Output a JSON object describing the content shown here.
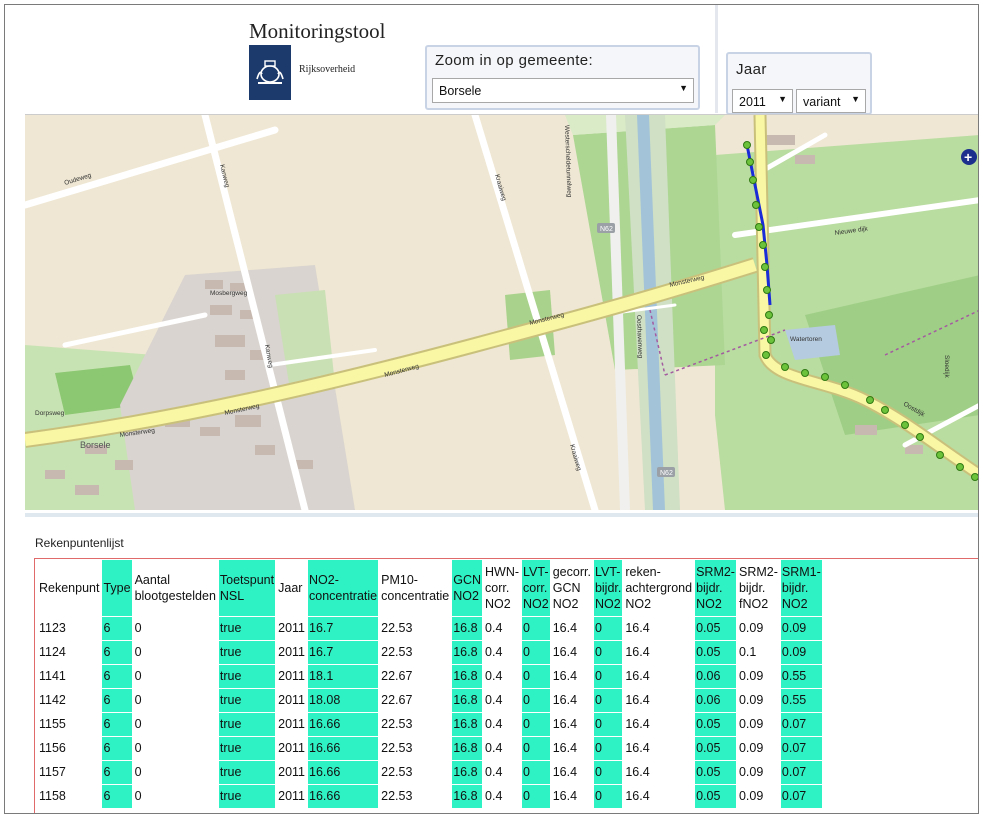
{
  "header": {
    "title": "Monitoringstool",
    "logo_text": "Rijksoverheid",
    "zoom_label": "Zoom in op gemeente:",
    "zoom_value": "Borsele",
    "year_label": "Jaar",
    "year_value": "2011",
    "variant_value": "variant"
  },
  "map": {
    "roads": {
      "oudeweg": "Oudeweg",
      "kanweg": "Kanweg",
      "kraaiweg": "Kraaiweg",
      "monsterweg1": "Monsterweg",
      "monsterweg2": "Monsterweg",
      "monsterweg3": "Monsterweg",
      "monsterweg4": "Monsterweg",
      "monsterweg5": "Monsterweg",
      "n62a": "N62",
      "n62b": "N62",
      "canal": "Westerscheldetunnelweg",
      "borsele": "Borsele",
      "dorpsweg": "Dorpsweg",
      "mosbergweg": "Mosbergweg",
      "oosthaven": "Oosthavenweg",
      "nieuwedijk": "Nieuwe dijk",
      "wavetreinhout": "Watertoren",
      "oostdijk": "Oostdijk",
      "zuidkanaal": "Sloedijk"
    },
    "colors": {
      "land": "#f1ead8",
      "green": "#a9d38c",
      "road": "#f9f6a4",
      "route": "#1a2bd8",
      "points": "#6cc23a"
    }
  },
  "table": {
    "caption": "Rekenpuntenlijst",
    "headers": [
      [
        "Rekenpunt"
      ],
      [
        "Type"
      ],
      [
        "Aantal",
        "blootgestelden"
      ],
      [
        "Toetspunt",
        "NSL"
      ],
      [
        "Jaar"
      ],
      [
        "NO2-",
        "concentratie"
      ],
      [
        "PM10-",
        "concentratie"
      ],
      [
        "GCN",
        "NO2"
      ],
      [
        "HWN-",
        "corr.",
        "NO2"
      ],
      [
        "LVT-",
        "corr.",
        "NO2"
      ],
      [
        "gecorr.",
        "GCN",
        "NO2"
      ],
      [
        "LVT-",
        "bijdr.",
        "NO2"
      ],
      [
        "reken-",
        "achtergrond",
        "NO2"
      ],
      [
        "SRM2-",
        "bijdr.",
        "NO2"
      ],
      [
        "SRM2-",
        "bijdr.",
        "fNO2"
      ],
      [
        "SRM1-",
        "bijdr.",
        "NO2"
      ]
    ],
    "rows": [
      [
        "1123",
        "6",
        "0",
        "true",
        "2011",
        "16.7",
        "22.53",
        "16.8",
        "0.4",
        "0",
        "16.4",
        "0",
        "16.4",
        "0.05",
        "0.09",
        "0.09"
      ],
      [
        "1124",
        "6",
        "0",
        "true",
        "2011",
        "16.7",
        "22.53",
        "16.8",
        "0.4",
        "0",
        "16.4",
        "0",
        "16.4",
        "0.05",
        "0.1",
        "0.09"
      ],
      [
        "1141",
        "6",
        "0",
        "true",
        "2011",
        "18.1",
        "22.67",
        "16.8",
        "0.4",
        "0",
        "16.4",
        "0",
        "16.4",
        "0.06",
        "0.09",
        "0.55"
      ],
      [
        "1142",
        "6",
        "0",
        "true",
        "2011",
        "18.08",
        "22.67",
        "16.8",
        "0.4",
        "0",
        "16.4",
        "0",
        "16.4",
        "0.06",
        "0.09",
        "0.55"
      ],
      [
        "1155",
        "6",
        "0",
        "true",
        "2011",
        "16.66",
        "22.53",
        "16.8",
        "0.4",
        "0",
        "16.4",
        "0",
        "16.4",
        "0.05",
        "0.09",
        "0.07"
      ],
      [
        "1156",
        "6",
        "0",
        "true",
        "2011",
        "16.66",
        "22.53",
        "16.8",
        "0.4",
        "0",
        "16.4",
        "0",
        "16.4",
        "0.05",
        "0.09",
        "0.07"
      ],
      [
        "1157",
        "6",
        "0",
        "true",
        "2011",
        "16.66",
        "22.53",
        "16.8",
        "0.4",
        "0",
        "16.4",
        "0",
        "16.4",
        "0.05",
        "0.09",
        "0.07"
      ],
      [
        "1158",
        "6",
        "0",
        "true",
        "2011",
        "16.66",
        "22.53",
        "16.8",
        "0.4",
        "0",
        "16.4",
        "0",
        "16.4",
        "0.05",
        "0.09",
        "0.07"
      ]
    ],
    "highlight_color": "#2ef2c4"
  }
}
